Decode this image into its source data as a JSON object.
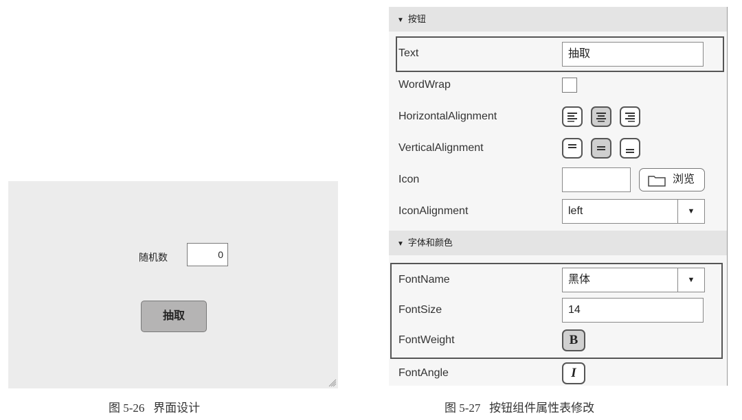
{
  "design": {
    "field_label": "随机数",
    "field_value": "0",
    "button_label": "抽取"
  },
  "inspector": {
    "sections": {
      "button": "按钮",
      "font_color": "字体和颜色"
    },
    "props": {
      "text": {
        "name": "Text",
        "value": "抽取"
      },
      "wordwrap": {
        "name": "WordWrap",
        "checked": false
      },
      "halign": {
        "name": "HorizontalAlignment",
        "selected": "center"
      },
      "valign": {
        "name": "VerticalAlignment",
        "selected": "middle"
      },
      "icon": {
        "name": "Icon",
        "value": "",
        "browse_label": "浏览"
      },
      "iconalign": {
        "name": "IconAlignment",
        "value": "left"
      },
      "fontname": {
        "name": "FontName",
        "value": "黑体"
      },
      "fontsize": {
        "name": "FontSize",
        "value": "14"
      },
      "fontweight": {
        "name": "FontWeight",
        "button": "B",
        "pressed": true
      },
      "fontangle": {
        "name": "FontAngle",
        "button": "I",
        "pressed": false
      }
    }
  },
  "captions": {
    "left": "图 5-26   界面设计",
    "right": "图 5-27   按钮组件属性表修改"
  },
  "colors": {
    "canvas_bg": "#ececec",
    "button_bg": "#b5b4b4",
    "section_bg": "#e4e4e4",
    "highlight_border": "#555555"
  }
}
